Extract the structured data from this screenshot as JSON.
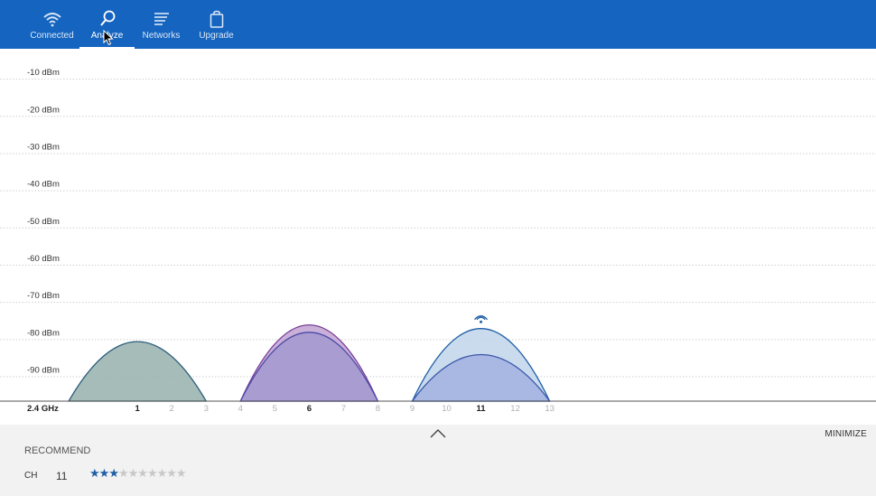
{
  "nav": {
    "tabs": [
      {
        "label": "Connected",
        "icon": "wifi-icon",
        "active": false
      },
      {
        "label": "Analyze",
        "icon": "magnifier-icon",
        "active": true
      },
      {
        "label": "Networks",
        "icon": "list-icon",
        "active": false
      },
      {
        "label": "Upgrade",
        "icon": "shopping-bag-icon",
        "active": false
      }
    ]
  },
  "colors": {
    "topbar": "#1565c0",
    "grid": "#cfcfcf",
    "baseline": "#555555",
    "ch1_fill": "#9db6b3",
    "ch1_stroke": "#2b5c7a",
    "ch6_outer_fill": "#c6a9d6",
    "ch6_outer_stroke": "#7a3f98",
    "ch6_inner_fill": "#a69ad0",
    "ch6_inner_stroke": "#4a4aa8",
    "ch11_outer_fill": "#c4d8ec",
    "ch11_outer_stroke": "#1f5fa8",
    "ch11_inner_fill": "#a6b4e2",
    "ch11_inner_stroke": "#3a56a8",
    "star_filled": "#1f5ea8",
    "star_empty": "#c8c8c8"
  },
  "chart_data": {
    "type": "area",
    "band_label": "2.4 GHz",
    "y_tick_labels": [
      "-10 dBm",
      "-20 dBm",
      "-30 dBm",
      "-40 dBm",
      "-50 dBm",
      "-60 dBm",
      "-70 dBm",
      "-80 dBm",
      "-90 dBm"
    ],
    "y_ticks": [
      -10,
      -20,
      -30,
      -40,
      -50,
      -60,
      -70,
      -80,
      -90
    ],
    "ylim": [
      -98.5,
      -5
    ],
    "x_ticks": [
      {
        "label": "1",
        "value": 1,
        "primary": true
      },
      {
        "label": "2",
        "value": 2,
        "primary": false
      },
      {
        "label": "3",
        "value": 3,
        "primary": false
      },
      {
        "label": "4",
        "value": 4,
        "primary": false
      },
      {
        "label": "5",
        "value": 5,
        "primary": false
      },
      {
        "label": "6",
        "value": 6,
        "primary": true
      },
      {
        "label": "7",
        "value": 7,
        "primary": false
      },
      {
        "label": "8",
        "value": 8,
        "primary": false
      },
      {
        "label": "9",
        "value": 9,
        "primary": false
      },
      {
        "label": "10",
        "value": 10,
        "primary": false
      },
      {
        "label": "11",
        "value": 11,
        "primary": true
      },
      {
        "label": "12",
        "value": 12,
        "primary": false
      },
      {
        "label": "13",
        "value": 13,
        "primary": false
      }
    ],
    "xlim": [
      -3,
      22.5
    ],
    "grid": true,
    "networks": [
      {
        "channel": 1,
        "span": [
          -1,
          3
        ],
        "peak_dbm": -82.5,
        "fill_key": "ch1_fill",
        "stroke_key": "ch1_stroke"
      },
      {
        "channel": 6,
        "span": [
          4,
          8
        ],
        "peak_dbm": -78,
        "fill_key": "ch6_outer_fill",
        "stroke_key": "ch6_outer_stroke"
      },
      {
        "channel": 6,
        "span": [
          4,
          8
        ],
        "peak_dbm": -80,
        "fill_key": "ch6_inner_fill",
        "stroke_key": "ch6_inner_stroke"
      },
      {
        "channel": 11,
        "span": [
          9,
          13
        ],
        "peak_dbm": -79,
        "fill_key": "ch11_outer_fill",
        "stroke_key": "ch11_outer_stroke",
        "connected": true
      },
      {
        "channel": 11,
        "span": [
          9,
          13
        ],
        "peak_dbm": -86,
        "fill_key": "ch11_inner_fill",
        "stroke_key": "ch11_inner_stroke"
      }
    ]
  },
  "bottom": {
    "expand_icon": "chevron-up-icon",
    "minimize_label": "MINIMIZE",
    "recommend_title": "RECOMMEND",
    "ch_label": "CH",
    "ch_value": "11",
    "rating": 3,
    "rating_max": 10
  }
}
